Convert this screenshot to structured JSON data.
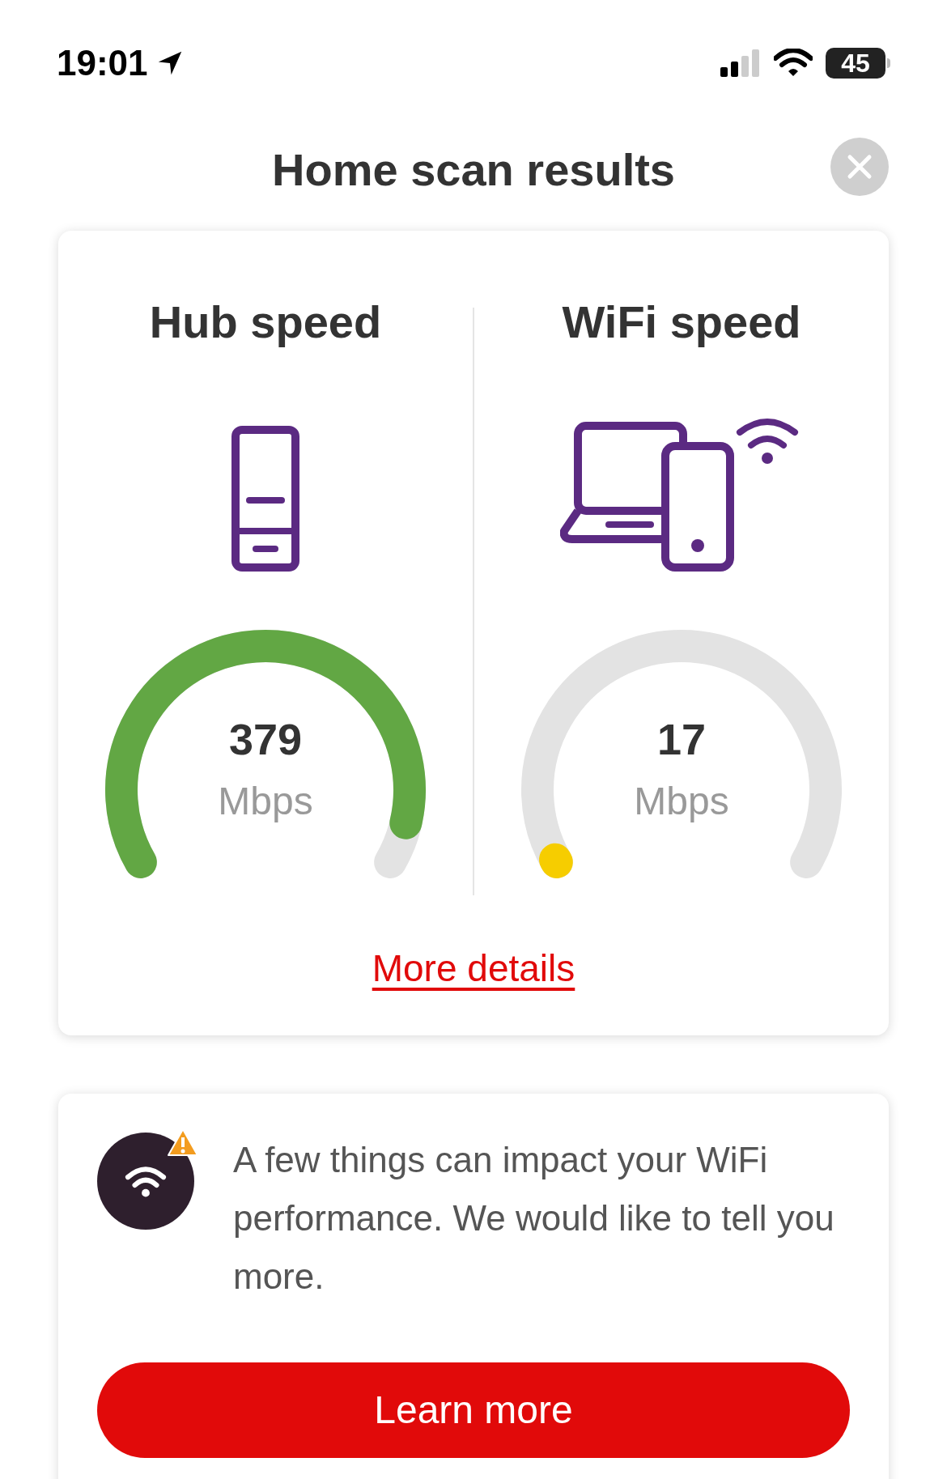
{
  "status_bar": {
    "time": "19:01",
    "battery": "45"
  },
  "title": "Home scan results",
  "speeds": [
    {
      "kind": "hub",
      "title": "Hub speed",
      "value": "379",
      "unit": "Mbps",
      "color": "#62a744"
    },
    {
      "kind": "wifi",
      "title": "WiFi speed",
      "value": "17",
      "unit": "Mbps",
      "color": "#f6cd00"
    }
  ],
  "more_details": "More details",
  "notice": {
    "text": "A few things can impact your WiFi performance. We would like to tell you more.",
    "button": "Learn more"
  }
}
